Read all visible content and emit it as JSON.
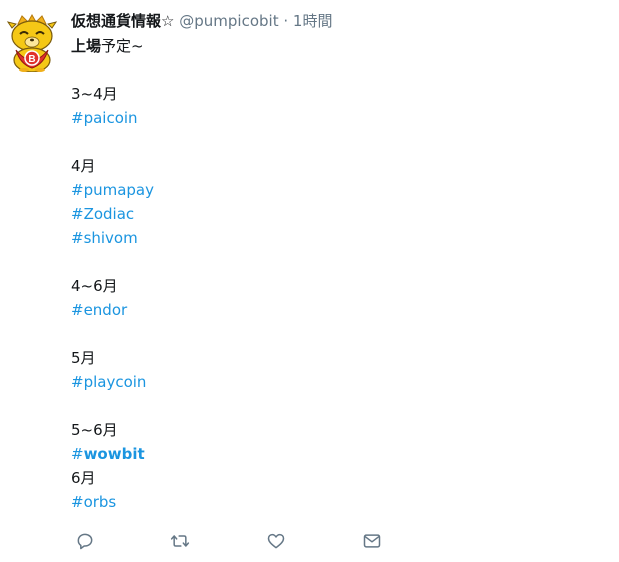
{
  "tweet": {
    "display_name": "仮想通貨情報",
    "name_symbol": "☆",
    "handle": "@pumpicobit",
    "separator": "·",
    "time": "1時間",
    "intro_bold": "上場",
    "intro_rest": "予定~",
    "sections": [
      {
        "heading": "3~4月",
        "tags": [
          "#paicoin"
        ]
      },
      {
        "heading": "4月",
        "tags": [
          "#pumapay",
          "#Zodiac",
          "#shivom"
        ]
      },
      {
        "heading": "4~6月",
        "tags": [
          "#endor"
        ]
      },
      {
        "heading": "5月",
        "tags": [
          "#playcoin"
        ]
      },
      {
        "heading": "5~6月",
        "tags_bold": [
          {
            "hash": "#",
            "word": "wowbit"
          }
        ]
      },
      {
        "heading": "6月",
        "tags": [
          "#orbs"
        ]
      }
    ]
  },
  "actions": {
    "reply_icon": "reply-icon",
    "retweet_icon": "retweet-icon",
    "like_icon": "heart-icon",
    "dm_icon": "envelope-icon"
  },
  "colors": {
    "link": "#1b95e0",
    "muted": "#657786",
    "text": "#14171a",
    "avatar_body": "#f5c816",
    "avatar_cape": "#e0312c"
  }
}
